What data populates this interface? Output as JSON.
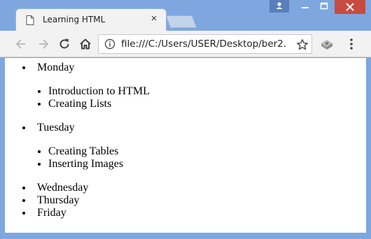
{
  "tab": {
    "title": "Learning HTML",
    "close_glyph": "×"
  },
  "omnibox": {
    "url": "file:///C:/Users/USER/Desktop/ber2."
  },
  "colors": {
    "frame": "#7ea7e0",
    "close": "#c74c40"
  },
  "content": {
    "days": [
      {
        "label": "Monday",
        "topics": [
          "Introduction to HTML",
          "Creating Lists"
        ]
      },
      {
        "label": "Tuesday",
        "topics": [
          "Creating Tables",
          "Inserting Images"
        ]
      },
      {
        "label": "Wednesday",
        "topics": []
      },
      {
        "label": "Thursday",
        "topics": []
      },
      {
        "label": "Friday",
        "topics": []
      }
    ]
  }
}
